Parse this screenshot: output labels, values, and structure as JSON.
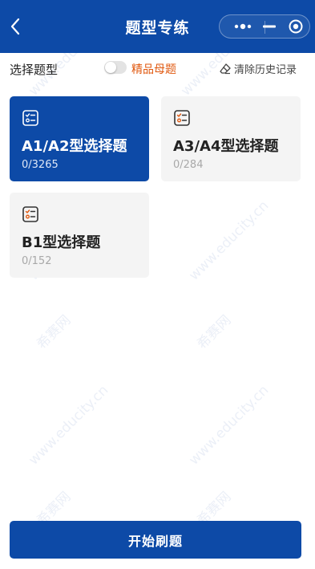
{
  "header": {
    "title": "题型专练"
  },
  "filter": {
    "label": "选择题型",
    "toggle_label": "精品母题",
    "toggle_on": false,
    "clear_label": "清除历史记录"
  },
  "cards": [
    {
      "name": "A1/A2型选择题",
      "count": "0/3265",
      "selected": true
    },
    {
      "name": "A3/A4型选择题",
      "count": "0/284",
      "selected": false
    },
    {
      "name": "B1型选择题",
      "count": "0/152",
      "selected": false
    }
  ],
  "watermark": {
    "url": "www.educity.cn",
    "brand": "希赛网"
  },
  "start_button": {
    "label": "开始刷题"
  },
  "colors": {
    "primary": "#0d4aa7",
    "accent": "#e0580f",
    "card_bg": "#f4f4f4"
  }
}
